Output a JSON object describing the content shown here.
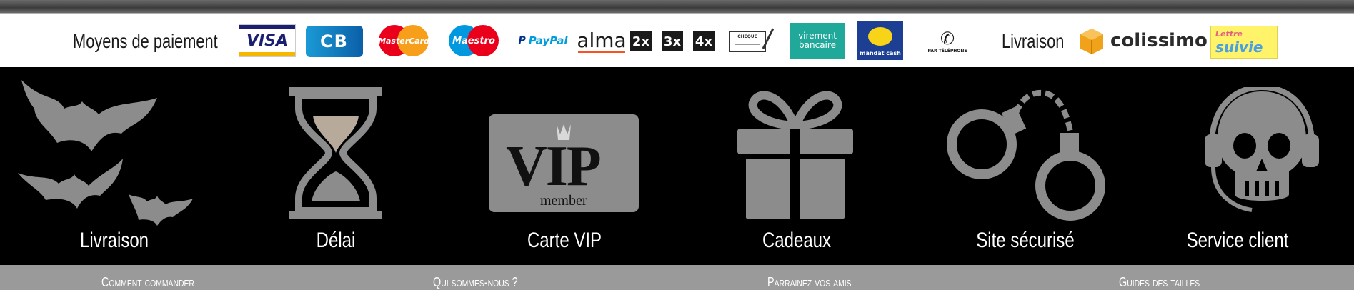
{
  "payment": {
    "label": "Moyens de paiement",
    "logos": {
      "visa": "VISA",
      "cb": "CB",
      "mastercard": "MasterCard",
      "maestro": "Maestro",
      "paypal": "PayPal",
      "alma": "alma",
      "alma_2x": "2x",
      "alma_3x": "3x",
      "alma_4x": "4x",
      "cheque": "CHEQUE",
      "virement": "virement bancaire",
      "mandat_cash": "mandat cash",
      "telephone": "PAR TÉLÉPHONE"
    }
  },
  "delivery": {
    "label": "Livraison",
    "colissimo": "colissimo",
    "lettre": "Lettre",
    "suivie": "suivie"
  },
  "features": [
    {
      "label": "Livraison",
      "icon": "bats-icon"
    },
    {
      "label": "Délai",
      "icon": "hourglass-icon"
    },
    {
      "label": "Carte VIP",
      "icon": "vip-card-icon",
      "vip_text": "VIP",
      "member_text": "member"
    },
    {
      "label": "Cadeaux",
      "icon": "gift-icon"
    },
    {
      "label": "Site sécurisé",
      "icon": "handcuffs-icon"
    },
    {
      "label": "Service client",
      "icon": "skull-headset-icon"
    }
  ],
  "links": [
    {
      "label": "Comment commander"
    },
    {
      "label": "Qui sommes-nous ?"
    },
    {
      "label": "Parrainez vos amis"
    },
    {
      "label": "Guides des tailles"
    }
  ],
  "colors": {
    "feature_bg": "#000000",
    "icon_gray": "#8c8c8c",
    "links_bg": "#9a9a9a"
  }
}
